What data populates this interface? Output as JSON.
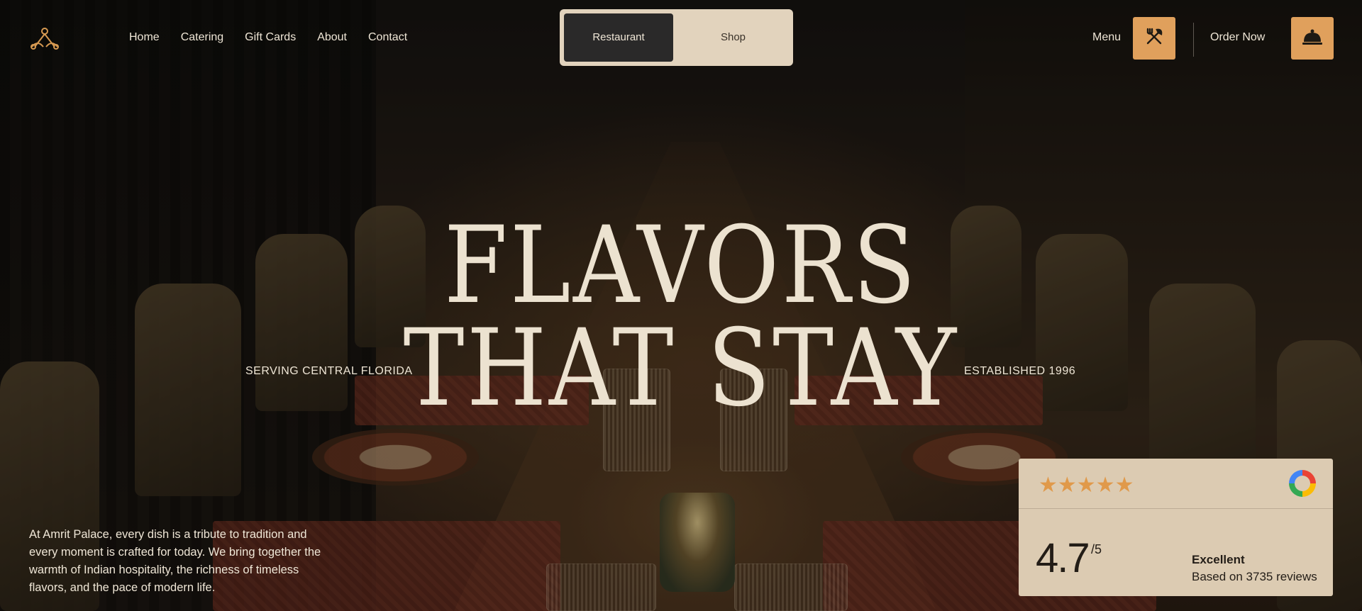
{
  "nav": {
    "links": [
      "Home",
      "Catering",
      "Gift Cards",
      "About",
      "Contact"
    ],
    "toggle": {
      "active": "Restaurant",
      "inactive": "Shop"
    },
    "menu_label": "Menu",
    "order_label": "Order Now",
    "menu_icon": "fork-knife-icon",
    "order_icon": "service-bell-icon"
  },
  "hero": {
    "line1": "FLAVORS",
    "line2": "THAT STAY",
    "left_tag": "SERVING CENTRAL FLORIDA",
    "right_tag": "ESTABLISHED 1996",
    "intro": "At Amrit Palace, every dish is a tribute to tradition and every moment is crafted for today. We bring together the warmth of Indian hospitality, the richness of timeless flavors, and the pace of modern life."
  },
  "review": {
    "stars": "★★★★★",
    "score": "4.7",
    "out_of": "/5",
    "rating_word": "Excellent",
    "based_on": "Based on 3735 reviews",
    "provider_icon": "google-icon"
  },
  "colors": {
    "accent": "#e0a05c",
    "panel": "#dccbb2",
    "toggle_bg": "#e2d3bd",
    "toggle_active": "#2a2929"
  }
}
